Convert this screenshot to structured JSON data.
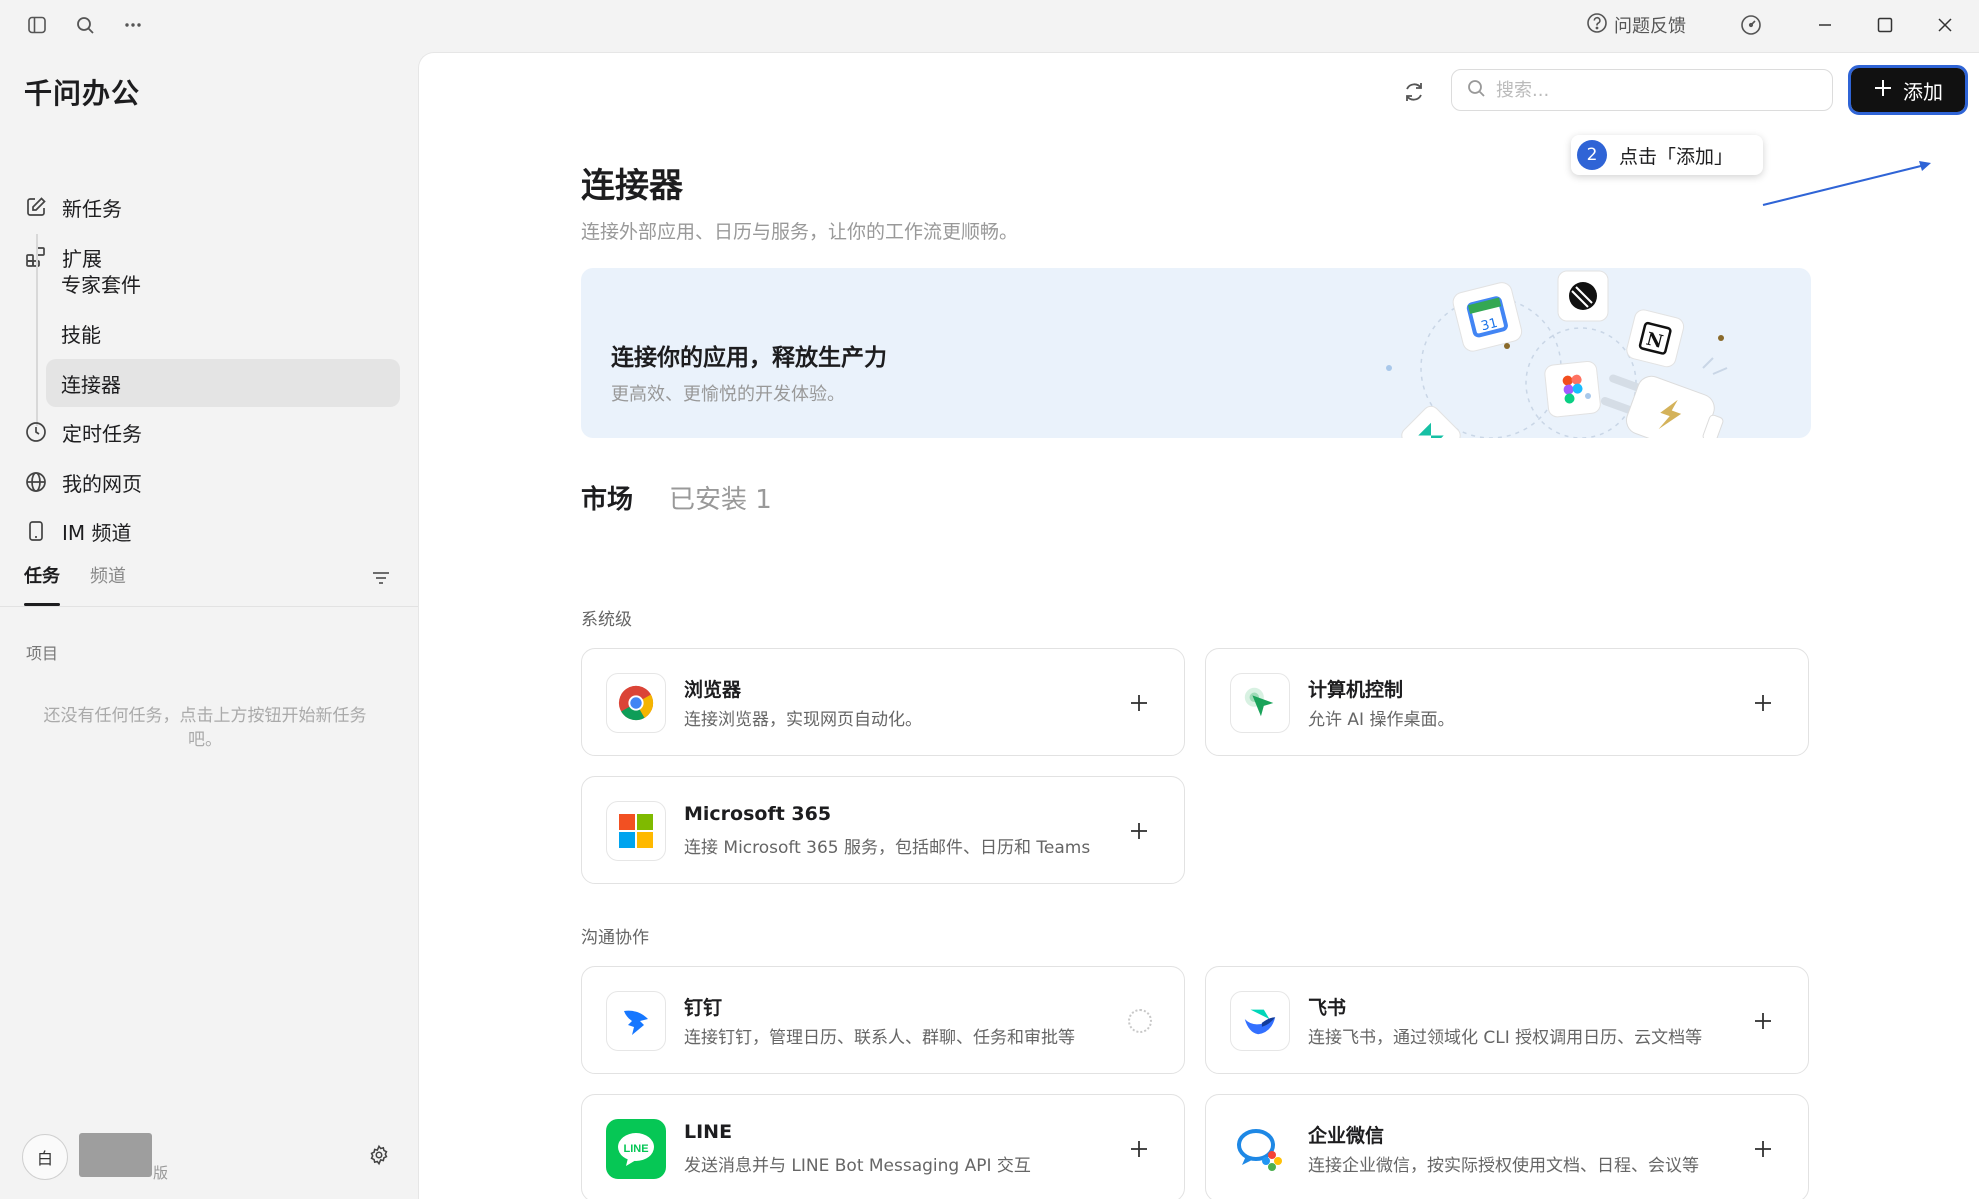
{
  "titlebar": {
    "feedback_label": "问题反馈"
  },
  "sidebar": {
    "app_title": "千问办公",
    "nav": [
      {
        "label": "新任务",
        "icon": "edit-icon"
      },
      {
        "label": "扩展",
        "icon": "extension-icon"
      }
    ],
    "sub_items": [
      {
        "label": "专家套件"
      },
      {
        "label": "技能"
      },
      {
        "label": "连接器",
        "active": true
      }
    ],
    "nav2": [
      {
        "label": "定时任务",
        "icon": "clock-icon"
      },
      {
        "label": "我的网页",
        "icon": "globe-icon"
      },
      {
        "label": "IM 频道",
        "icon": "phone-icon"
      }
    ],
    "tabs": [
      {
        "label": "任务",
        "active": true
      },
      {
        "label": "频道",
        "active": false
      }
    ],
    "section_label": "项目",
    "empty_text": "还没有任何任务，点击上方按钮开始新任务吧。",
    "user": {
      "avatar_text": "白",
      "plan_suffix": "版"
    }
  },
  "main": {
    "search_placeholder": "搜索...",
    "add_label": "添加",
    "tooltip": {
      "step": "2",
      "text": "点击「添加」"
    },
    "title": "连接器",
    "subtitle": "连接外部应用、日历与服务，让你的工作流更顺畅。",
    "banner": {
      "title": "连接你的应用，释放生产力",
      "subtitle": "更高效、更愉悦的开发体验。"
    },
    "market_tabs": [
      {
        "label": "市场",
        "active": true
      },
      {
        "label": "已安装 1",
        "active": false
      }
    ],
    "categories": [
      {
        "label": "系统级",
        "cards": [
          {
            "name": "浏览器",
            "desc": "连接浏览器，实现网页自动化。",
            "logo": "chrome-icon"
          },
          {
            "name": "计算机控制",
            "desc": "允许 AI 操作桌面。",
            "logo": "cursor-icon"
          },
          {
            "name": "Microsoft 365",
            "desc": "连接 Microsoft 365 服务，包括邮件、日历和 Teams",
            "logo": "microsoft-icon"
          }
        ]
      },
      {
        "label": "沟通协作",
        "cards": [
          {
            "name": "钉钉",
            "desc": "连接钉钉，管理日历、联系人、群聊、任务和审批等",
            "logo": "dingtalk-icon",
            "state": "loading"
          },
          {
            "name": "飞书",
            "desc": "连接飞书，通过领域化 CLI 授权调用日历、云文档等",
            "logo": "feishu-icon"
          },
          {
            "name": "LINE",
            "desc": "发送消息并与 LINE Bot Messaging API 交互",
            "logo": "line-icon"
          },
          {
            "name": "企业微信",
            "desc": "连接企业微信，按实际授权使用文档、日程、会议等",
            "logo": "wecom-icon"
          }
        ]
      }
    ]
  },
  "colors": {
    "accent": "#2f64d6",
    "primary_button": "#111111",
    "banner_bg": "#eaf2fb",
    "sidebar_bg": "#f3f3f3"
  }
}
